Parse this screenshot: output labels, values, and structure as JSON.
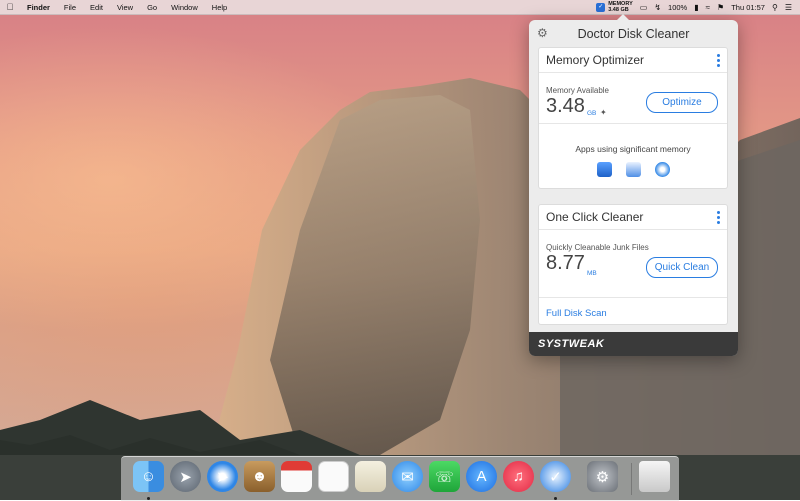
{
  "menubar": {
    "apple_icon": "apple-icon",
    "items": [
      "Finder",
      "File",
      "Edit",
      "View",
      "Go",
      "Window",
      "Help"
    ],
    "memory_indicator": {
      "label": "MEMORY",
      "value": "3.48 GB"
    },
    "battery": "100%",
    "clock": "Thu 01:57"
  },
  "panel": {
    "title": "Doctor Disk Cleaner",
    "memory_optimizer": {
      "title": "Memory Optimizer",
      "available_label": "Memory Available",
      "available_value": "3.48",
      "available_unit": "GB",
      "button": "Optimize",
      "apps_label": "Apps using significant memory",
      "apps": [
        "app-store-icon",
        "preview-icon",
        "safari-icon"
      ]
    },
    "one_click": {
      "title": "One Click Cleaner",
      "junk_label": "Quickly Cleanable Junk Files",
      "junk_value": "8.77",
      "junk_unit": "MB",
      "button": "Quick Clean",
      "full_scan": "Full Disk Scan"
    },
    "brand": "SYSTWEAK"
  },
  "colors": {
    "accent": "#2a7de1",
    "footer": "#3a3a3a"
  },
  "dock": {
    "items": [
      "finder-icon",
      "launchpad-icon",
      "safari-icon",
      "contacts-icon",
      "calendar-icon",
      "reminders-icon",
      "preview-icon",
      "messages-icon",
      "facetime-icon",
      "app-store-icon",
      "itunes-icon",
      "doctor-disk-cleaner-icon",
      "system-preferences-icon",
      "trash-icon"
    ]
  }
}
